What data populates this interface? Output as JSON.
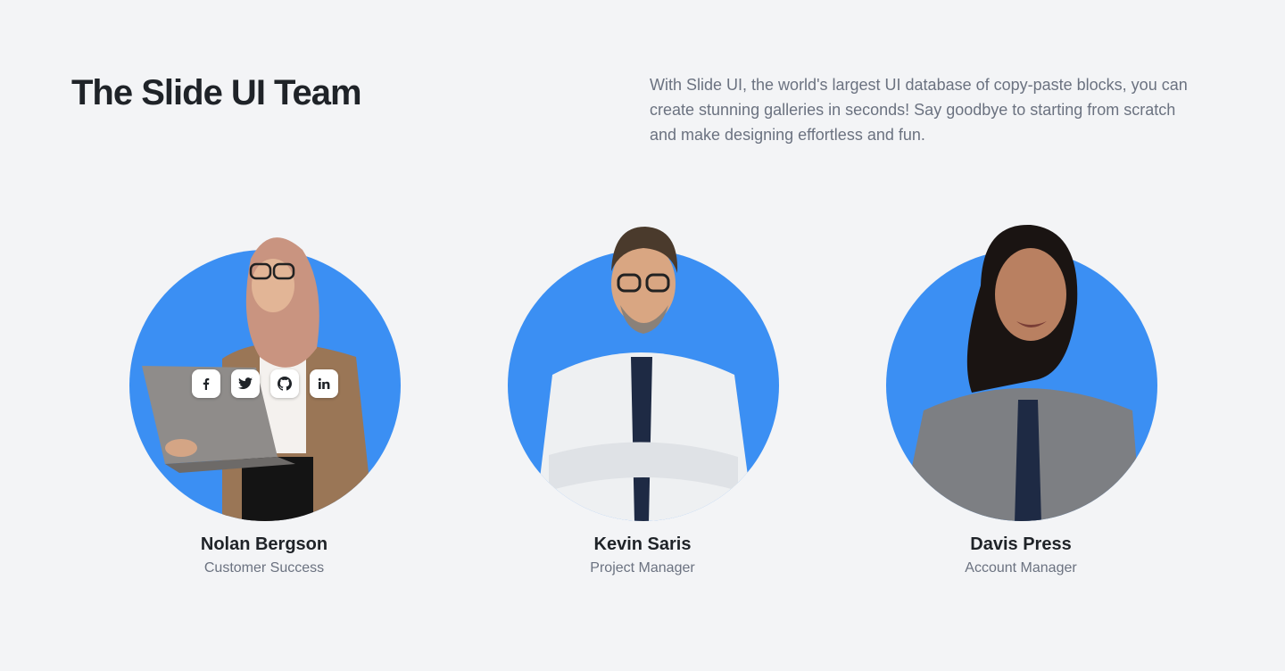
{
  "header": {
    "title": "The Slide UI Team",
    "description": "With Slide UI, the world's largest UI database of copy-paste blocks, you can create stunning galleries in seconds! Say goodbye to starting from scratch and make designing effortless and fun."
  },
  "colors": {
    "page_background": "#f3f4f6",
    "accent_circle": "#3b8ff3",
    "heading": "#1f2328",
    "muted_text": "#6b7280"
  },
  "team": [
    {
      "name": "Nolan Bergson",
      "role": "Customer Success",
      "social_links": [
        "facebook-icon",
        "twitter-icon",
        "github-icon",
        "linkedin-icon"
      ]
    },
    {
      "name": "Kevin Saris",
      "role": "Project Manager"
    },
    {
      "name": "Davis Press",
      "role": "Account Manager"
    }
  ]
}
